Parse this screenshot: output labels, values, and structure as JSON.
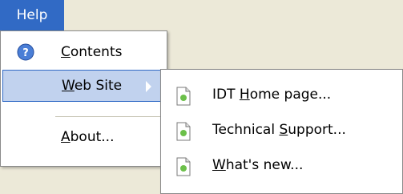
{
  "menubar": {
    "help_label": "Help"
  },
  "help_menu": {
    "items": [
      {
        "prefix": "",
        "accel": "C",
        "rest": "ontents",
        "icon": "help-circle-icon"
      },
      {
        "prefix": "",
        "accel": "W",
        "rest": "eb Site",
        "icon": ""
      },
      {
        "prefix": "",
        "accel": "A",
        "rest": "bout...",
        "icon": ""
      }
    ]
  },
  "website_submenu": {
    "items": [
      {
        "prefix": "IDT ",
        "accel": "H",
        "rest": "ome page...",
        "icon": "document-icon"
      },
      {
        "prefix": "Technical ",
        "accel": "S",
        "rest": "upport...",
        "icon": "document-icon"
      },
      {
        "prefix": "",
        "accel": "W",
        "rest": "hat's new...",
        "icon": "document-icon"
      }
    ]
  },
  "colors": {
    "menubar_selected": "#316ac5",
    "item_highlight": "#c1d2ee",
    "chrome_bg": "#ece9d8",
    "menu_bg": "#ffffff"
  }
}
